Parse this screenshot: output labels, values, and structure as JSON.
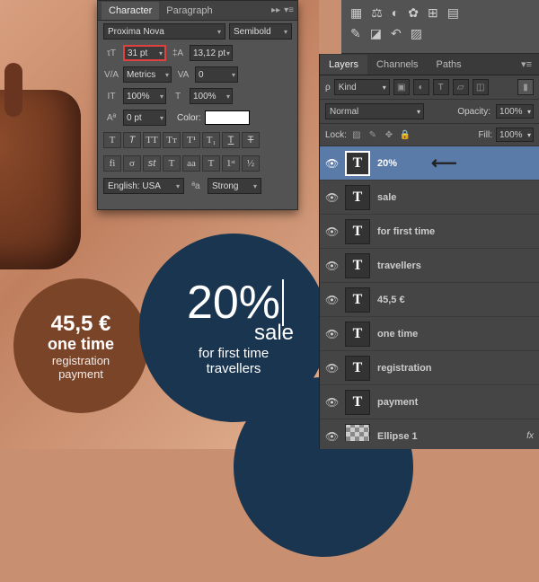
{
  "canvas": {
    "circle_brown": {
      "price": "45,5 €",
      "line2": "one time",
      "line3": "registration",
      "line4": "payment"
    },
    "circle_navy": {
      "big": "20%",
      "sale": "sale",
      "line3": "for first time",
      "line4": "travellers"
    }
  },
  "char_panel": {
    "tab_character": "Character",
    "tab_paragraph": "Paragraph",
    "font": "Proxima Nova",
    "weight": "Semibold",
    "size": "31 pt",
    "leading": "13,12 pt",
    "kerning": "Metrics",
    "tracking": "0",
    "scale_v": "100%",
    "scale_h": "100%",
    "baseline": "0 pt",
    "color_label": "Color:",
    "lang": "English: USA",
    "aa": "Strong"
  },
  "layers_panel": {
    "tab_layers": "Layers",
    "tab_channels": "Channels",
    "tab_paths": "Paths",
    "kind": "Kind",
    "blend": "Normal",
    "opacity_label": "Opacity:",
    "opacity_value": "100%",
    "lock_label": "Lock:",
    "fill_label": "Fill:",
    "fill_value": "100%",
    "layers": [
      {
        "name": "20%",
        "selected": true
      },
      {
        "name": "sale",
        "selected": false
      },
      {
        "name": "for first time",
        "selected": false
      },
      {
        "name": "travellers",
        "selected": false
      },
      {
        "name": "45,5 €",
        "selected": false
      },
      {
        "name": "one time",
        "selected": false
      },
      {
        "name": "registration",
        "selected": false
      },
      {
        "name": "payment",
        "selected": false
      },
      {
        "name": "Ellipse 1",
        "selected": false,
        "shape": true,
        "fx": "fx"
      }
    ]
  }
}
